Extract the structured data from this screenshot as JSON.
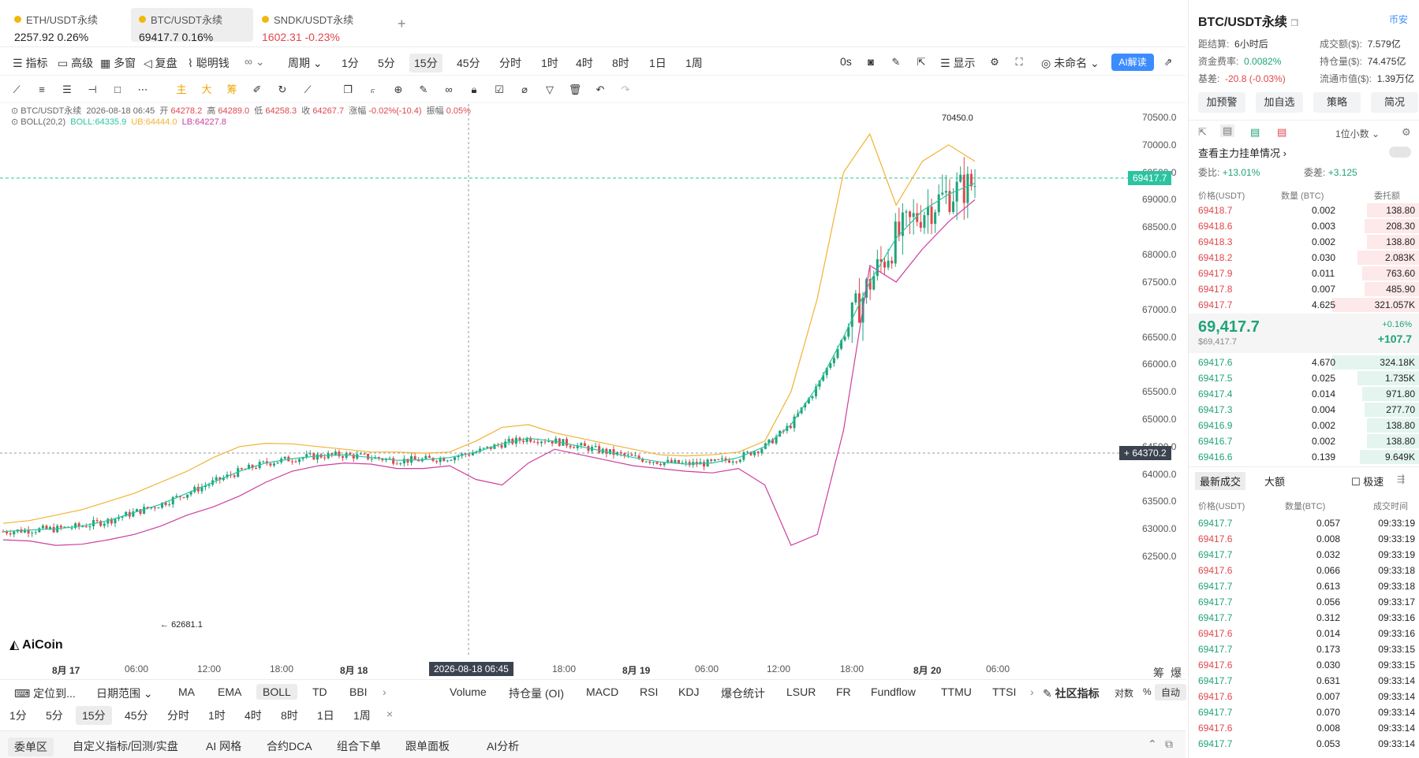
{
  "tabs": [
    {
      "name": "ETH/USDT永续",
      "price": "2257.92",
      "change": "0.26%",
      "color": "#222"
    },
    {
      "name": "BTC/USDT永续",
      "price": "69417.7",
      "change": "0.16%",
      "color": "#222"
    },
    {
      "name": "SNDK/USDT永续",
      "price": "1602.31",
      "change": "-0.23%",
      "color": "#e0474d"
    }
  ],
  "add_tab": "+",
  "toolbar": {
    "indicator": "指标",
    "advanced": "高级",
    "multi_window": "多窗",
    "replay": "复盘",
    "smart_money": "聪明钱",
    "period": "周期",
    "periods": [
      "1分",
      "5分",
      "15分",
      "45分",
      "分时",
      "1时",
      "4时",
      "8时",
      "1日",
      "1周"
    ],
    "countdown": "0s",
    "display": "显示",
    "unnamed": "未命名",
    "ai": "AI解读"
  },
  "drawbar": {
    "zhu": "主",
    "da": "大",
    "chou": "筹"
  },
  "chart": {
    "symbol_line": "BTC/USDT永续",
    "datetime": "2026-08-18 06:45",
    "open_label": "开",
    "open": "64278.2",
    "high_label": "高",
    "high": "64289.0",
    "low_label": "低",
    "low": "64258.3",
    "close_label": "收",
    "close": "64267.7",
    "range_label": "涨幅",
    "range": "-0.02%(-10.4)",
    "amp_label": "振幅",
    "amp": "0.05%",
    "boll_label": "BOLL(20,2)",
    "boll": "BOLL:64335.9",
    "ub": "UB:64444.0",
    "lb": "LB:64227.8",
    "max_label": "70450.0",
    "min_label": "62681.1",
    "current_price": "69417.7",
    "crosshair_price": "64370.2",
    "crosshair_time": "2026-08-18 06:45",
    "logo": "AiCoin",
    "corner": [
      "筹",
      "爆"
    ],
    "price_ticks": [
      "70500.0",
      "70000.0",
      "69500.0",
      "69000.0",
      "68500.0",
      "68000.0",
      "67500.0",
      "67000.0",
      "66500.0",
      "66000.0",
      "65500.0",
      "65000.0",
      "64500.0",
      "64000.0",
      "63500.0",
      "63000.0",
      "62500.0"
    ],
    "time_ticks": [
      "8月 17",
      "06:00",
      "12:00",
      "18:00",
      "8月 18",
      "12:00",
      "18:00",
      "8月 19",
      "06:00",
      "12:00",
      "18:00",
      "8月 20",
      "06:00"
    ]
  },
  "chart_data": {
    "type": "line",
    "title": "BTC/USDT永续",
    "xlabel": "",
    "ylabel": "",
    "ylim": [
      62500,
      70500
    ],
    "series": [
      {
        "name": "BOLL",
        "values": [
          62950,
          62980,
          63000,
          63050,
          63150,
          63300,
          63450,
          63650,
          63850,
          64050,
          64200,
          64280,
          64330,
          64350,
          64300,
          64250,
          64260,
          64300,
          64400,
          64550,
          64650,
          64600,
          64500,
          64400,
          64300,
          64220,
          64180,
          64200,
          64300,
          64500,
          64900,
          65600,
          66500,
          67500,
          68300,
          68800,
          69100,
          69300
        ]
      },
      {
        "name": "UB",
        "values": [
          63100,
          63150,
          63250,
          63350,
          63500,
          63650,
          63850,
          64050,
          64300,
          64500,
          64560,
          64550,
          64500,
          64450,
          64400,
          64400,
          64380,
          64400,
          64600,
          64850,
          64900,
          64750,
          64650,
          64550,
          64450,
          64350,
          64330,
          64350,
          64400,
          64600,
          65500,
          67200,
          69500,
          70200,
          68900,
          69700,
          70000,
          69700
        ]
      },
      {
        "name": "LB",
        "values": [
          62800,
          62780,
          62700,
          62720,
          62800,
          62900,
          63050,
          63250,
          63400,
          63600,
          63850,
          64050,
          64150,
          64200,
          64180,
          64100,
          64100,
          64150,
          63900,
          63800,
          64200,
          64450,
          64350,
          64250,
          64150,
          64100,
          64050,
          64020,
          64100,
          63800,
          62700,
          62900,
          64800,
          67800,
          67500,
          68100,
          68600,
          69000
        ]
      }
    ]
  },
  "bottom": {
    "locate": "定位到...",
    "date_range": "日期范围",
    "main_ind": [
      "MA",
      "EMA",
      "BOLL",
      "TD",
      "BBI"
    ],
    "sub_ind": [
      "Volume",
      "持仓量 (OI)",
      "MACD",
      "RSI",
      "KDJ",
      "爆仓统计",
      "LSUR",
      "FR",
      "Fundflow",
      "TTMU",
      "TTSI"
    ],
    "community": "社区指标",
    "log": "对数",
    "pct": "%",
    "auto": "自动",
    "periods": [
      "1分",
      "5分",
      "15分",
      "45分",
      "分时",
      "1时",
      "4时",
      "8时",
      "1日",
      "1周"
    ],
    "close": "×"
  },
  "footer": {
    "tabs": [
      "委单区",
      "自定义指标/回测/实盘",
      "AI 网格",
      "合约DCA",
      "组合下单",
      "跟单面板",
      "AI分析"
    ]
  },
  "right": {
    "title": "BTC/USDT永续",
    "exchange": "币安",
    "settle_label": "距结算:",
    "settle": "6小时后",
    "volume_label": "成交额($):",
    "volume": "7.579亿",
    "funding_label": "资金费率:",
    "funding": "0.0082%",
    "oi_label": "持仓量($):",
    "oi": "74.475亿",
    "basis_label": "基差:",
    "basis": "-20.8 (-0.03%)",
    "mcap_label": "流通市值($):",
    "mcap": "1.39万亿",
    "buttons": [
      "加预警",
      "加自选",
      "策略",
      "简况"
    ],
    "decimal": "1位小数",
    "main_orders": "查看主力挂单情况",
    "ratio_label": "委比:",
    "ratio": "+13.01%",
    "diff_label": "委差:",
    "diff": "+3.125",
    "ob_headers": [
      "价格(USDT)",
      "数量 (BTC)",
      "委托额"
    ],
    "asks": [
      {
        "p": "69418.7",
        "q": "0.002",
        "a": "138.80",
        "w": 0.23
      },
      {
        "p": "69418.6",
        "q": "0.003",
        "a": "208.30",
        "w": 0.24
      },
      {
        "p": "69418.3",
        "q": "0.002",
        "a": "138.80",
        "w": 0.23
      },
      {
        "p": "69418.2",
        "q": "0.030",
        "a": "2.083K",
        "w": 0.27
      },
      {
        "p": "69417.9",
        "q": "0.011",
        "a": "763.60",
        "w": 0.25
      },
      {
        "p": "69417.8",
        "q": "0.007",
        "a": "485.90",
        "w": 0.24
      },
      {
        "p": "69417.7",
        "q": "4.625",
        "a": "321.057K",
        "w": 0.38
      }
    ],
    "last_price": "69,417.7",
    "last_usd": "$69,417.7",
    "last_pct": "+0.16%",
    "last_chg": "+107.7",
    "bids": [
      {
        "p": "69417.6",
        "q": "4.670",
        "a": "324.18K",
        "w": 0.38
      },
      {
        "p": "69417.5",
        "q": "0.025",
        "a": "1.735K",
        "w": 0.27
      },
      {
        "p": "69417.4",
        "q": "0.014",
        "a": "971.80",
        "w": 0.25
      },
      {
        "p": "69417.3",
        "q": "0.004",
        "a": "277.70",
        "w": 0.24
      },
      {
        "p": "69416.9",
        "q": "0.002",
        "a": "138.80",
        "w": 0.23
      },
      {
        "p": "69416.7",
        "q": "0.002",
        "a": "138.80",
        "w": 0.23
      },
      {
        "p": "69416.6",
        "q": "0.139",
        "a": "9.649K",
        "w": 0.26
      }
    ],
    "trades_tab": "最新成交",
    "big_tab": "大额",
    "fast": "极速",
    "tr_headers": [
      "价格(USDT)",
      "数量(BTC)",
      "成交时间"
    ],
    "trades": [
      {
        "p": "69417.7",
        "q": "0.057",
        "t": "09:33:19",
        "s": "b"
      },
      {
        "p": "69417.6",
        "q": "0.008",
        "t": "09:33:19",
        "s": "s"
      },
      {
        "p": "69417.7",
        "q": "0.032",
        "t": "09:33:19",
        "s": "b"
      },
      {
        "p": "69417.6",
        "q": "0.066",
        "t": "09:33:18",
        "s": "s"
      },
      {
        "p": "69417.7",
        "q": "0.613",
        "t": "09:33:18",
        "s": "b"
      },
      {
        "p": "69417.7",
        "q": "0.056",
        "t": "09:33:17",
        "s": "b"
      },
      {
        "p": "69417.7",
        "q": "0.312",
        "t": "09:33:16",
        "s": "b"
      },
      {
        "p": "69417.6",
        "q": "0.014",
        "t": "09:33:16",
        "s": "s"
      },
      {
        "p": "69417.7",
        "q": "0.173",
        "t": "09:33:15",
        "s": "b"
      },
      {
        "p": "69417.6",
        "q": "0.030",
        "t": "09:33:15",
        "s": "s"
      },
      {
        "p": "69417.7",
        "q": "0.631",
        "t": "09:33:14",
        "s": "b"
      },
      {
        "p": "69417.6",
        "q": "0.007",
        "t": "09:33:14",
        "s": "s"
      },
      {
        "p": "69417.7",
        "q": "0.070",
        "t": "09:33:14",
        "s": "b"
      },
      {
        "p": "69417.6",
        "q": "0.008",
        "t": "09:33:14",
        "s": "s"
      },
      {
        "p": "69417.7",
        "q": "0.053",
        "t": "09:33:14",
        "s": "b"
      }
    ]
  },
  "colors": {
    "up": "#1fa37a",
    "down": "#e0474d",
    "ub": "#f2b233",
    "lb": "#cc3f9e",
    "boll": "#2cc4a0",
    "accent": "#3b8cff"
  }
}
